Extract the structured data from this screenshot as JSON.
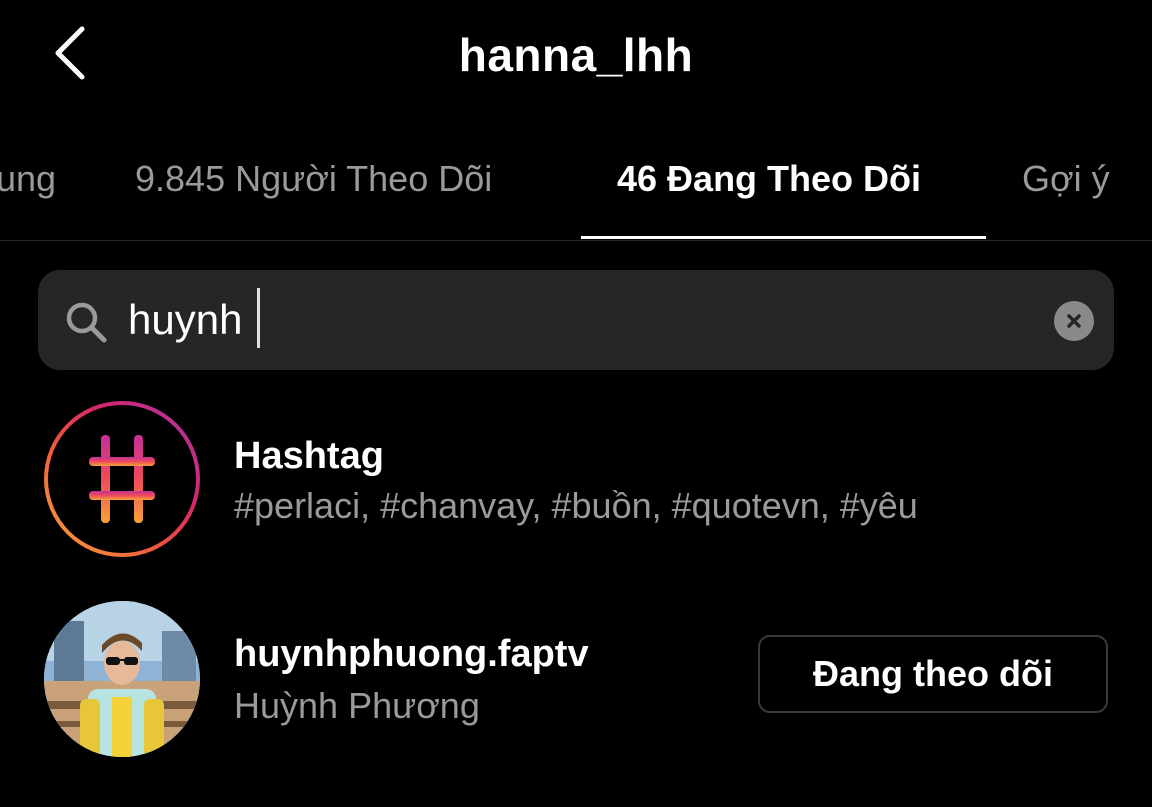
{
  "header": {
    "title": "hanna_lhh",
    "back_icon": "chevron-left-icon"
  },
  "tabs": [
    {
      "label": "ung",
      "active": false
    },
    {
      "label": "9.845 Người Theo Dõi",
      "active": false
    },
    {
      "label": "46 Đang Theo Dõi",
      "active": true
    },
    {
      "label": "Gợi ý",
      "active": false
    }
  ],
  "search": {
    "value": "huynh",
    "icon": "search-icon",
    "clear_icon": "clear-icon"
  },
  "results": [
    {
      "type": "hashtag",
      "title": "Hashtag",
      "subtitle": "#perlaci, #chanvay, #buồn, #quotevn, #yêu",
      "icon": "hashtag-icon"
    },
    {
      "type": "user",
      "username": "huynhphuong.faptv",
      "name": "Huỳnh Phương",
      "button_label": "Đang theo dõi"
    }
  ],
  "colors": {
    "background": "#000000",
    "search_bg": "#262626",
    "secondary_text": "#9a9a9a",
    "button_border": "#3a3a3a"
  }
}
